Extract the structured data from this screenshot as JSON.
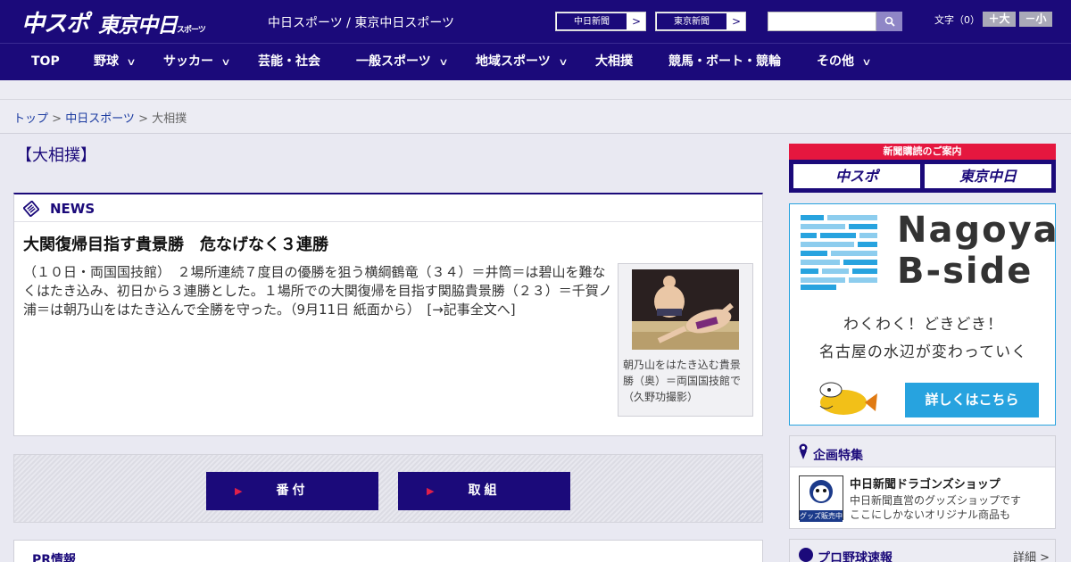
{
  "header": {
    "logo_chuspo": "中スポ",
    "logo_tokyo": "東京中日",
    "logo_tokyo_small": "スポーツ",
    "site_title": "中日スポーツ / 東京中日スポーツ",
    "paper_links": [
      "中日新聞",
      "東京新聞"
    ],
    "search_placeholder": "",
    "fontsize_label": "文字（0）",
    "fontsize_plus": "＋大",
    "fontsize_minus": "－小"
  },
  "nav": [
    {
      "label": "TOP",
      "has_dropdown": false
    },
    {
      "label": "野球",
      "has_dropdown": true
    },
    {
      "label": "サッカー",
      "has_dropdown": true
    },
    {
      "label": "芸能・社会",
      "has_dropdown": false
    },
    {
      "label": "一般スポーツ",
      "has_dropdown": true
    },
    {
      "label": "地域スポーツ",
      "has_dropdown": true
    },
    {
      "label": "大相撲",
      "has_dropdown": false
    },
    {
      "label": "競馬・ボート・競輪",
      "has_dropdown": false
    },
    {
      "label": "その他",
      "has_dropdown": true
    }
  ],
  "breadcrumb": {
    "home": "トップ",
    "sep1": " > ",
    "section": "中日スポーツ",
    "sep2": " > ",
    "current": "大相撲"
  },
  "page_heading": "【大相撲】",
  "news": {
    "label": "NEWS",
    "headline": "大関復帰目指す貴景勝　危なげなく３連勝",
    "body": "（１０日・両国国技館）　２場所連続７度目の優勝を狙う横綱鶴竜（３４）＝井筒＝は碧山を難なくはたき込み、初日から３連勝とした。１場所での大関復帰を目指す関脇貴景勝（２３）＝千賀ノ浦＝は朝乃山をはたき込んで全勝を守った。（9月11日 紙面から）　[→記事全文へ]",
    "photo_caption": "朝乃山をはたき込む貴景勝（奥）＝両国国技館で（久野功撮影）"
  },
  "buttons": {
    "banzuke": "番付",
    "torikumi": "取組"
  },
  "pr_label": "PR情報",
  "sidebar": {
    "subscribe_title": "新聞購読のご案内",
    "subscribe_logo1": "中スポ",
    "subscribe_logo2": "東京中日",
    "bside_title_line1": "Nagoya",
    "bside_title_line2": "B-side",
    "bside_tagline1": "わくわく！どきどき！",
    "bside_tagline2": "名古屋の水辺が変わっていく",
    "bside_button": "詳しくはこちら",
    "feature_title": "企画特集",
    "shop_name": "中日新聞ドラゴンズショップ",
    "shop_desc_line1": "中日新聞直営のグッズショップです",
    "shop_desc_line2": "ここにしかないオリジナル商品も",
    "shop_thumb_text": "グッズ販売中",
    "baseball_title": "プロ野球速報",
    "baseball_more": "詳細 >"
  },
  "colors": {
    "brand_navy": "#1b0a7a",
    "accent_red": "#e5173f",
    "bside_blue": "#27a3df"
  }
}
